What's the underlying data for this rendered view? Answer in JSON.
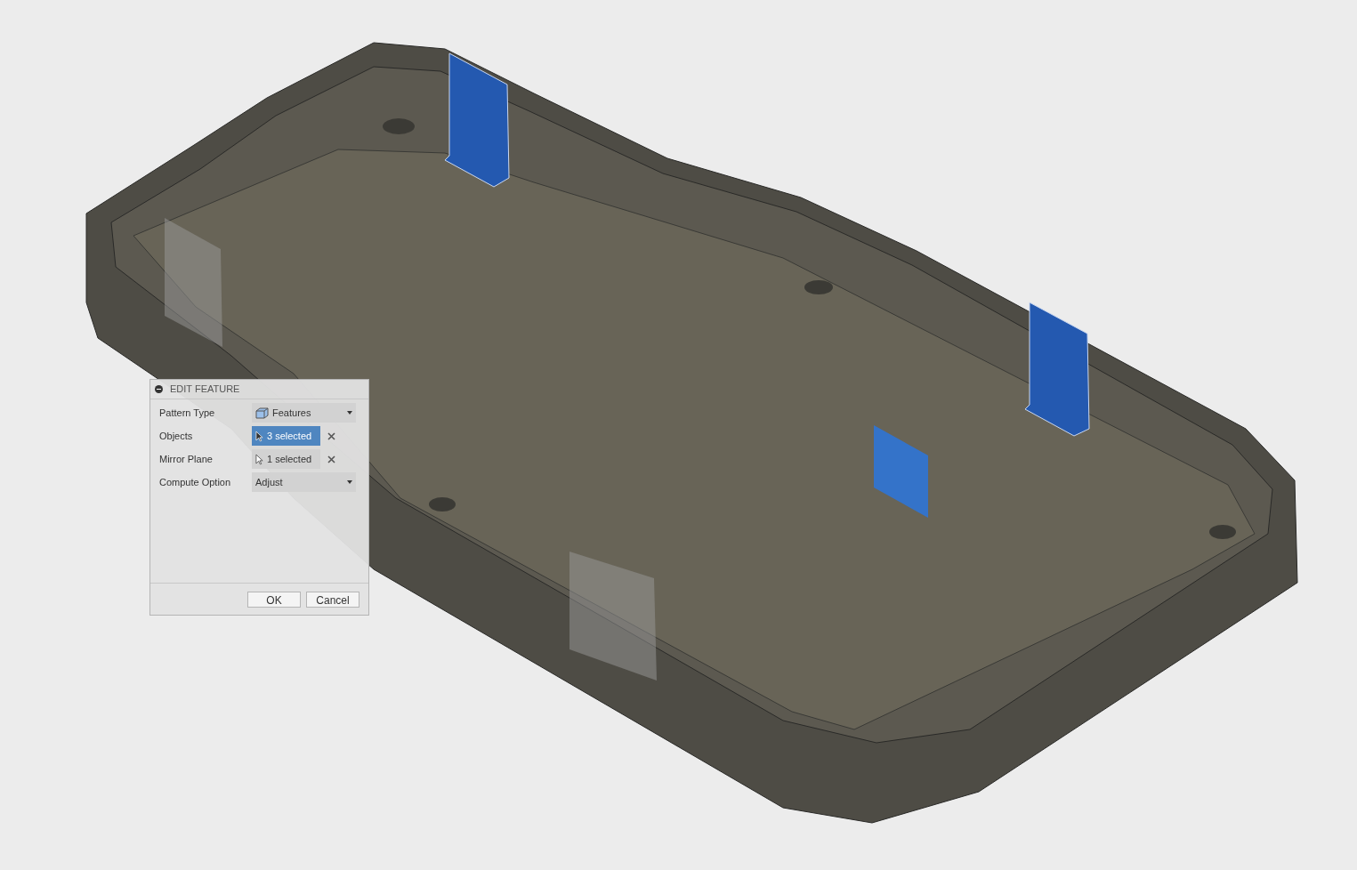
{
  "dialog": {
    "title": "EDIT FEATURE",
    "rows": [
      {
        "kind": "dropdown",
        "label": "Pattern Type",
        "value": "Features",
        "icon": true
      },
      {
        "kind": "selection",
        "label": "Objects",
        "value": "3 selected",
        "selected": true
      },
      {
        "kind": "selection",
        "label": "Mirror Plane",
        "value": "1 selected",
        "selected": false
      },
      {
        "kind": "dropdown",
        "label": "Compute Option",
        "value": "Adjust",
        "icon": false
      }
    ],
    "buttons": [
      "OK",
      "Cancel"
    ]
  }
}
